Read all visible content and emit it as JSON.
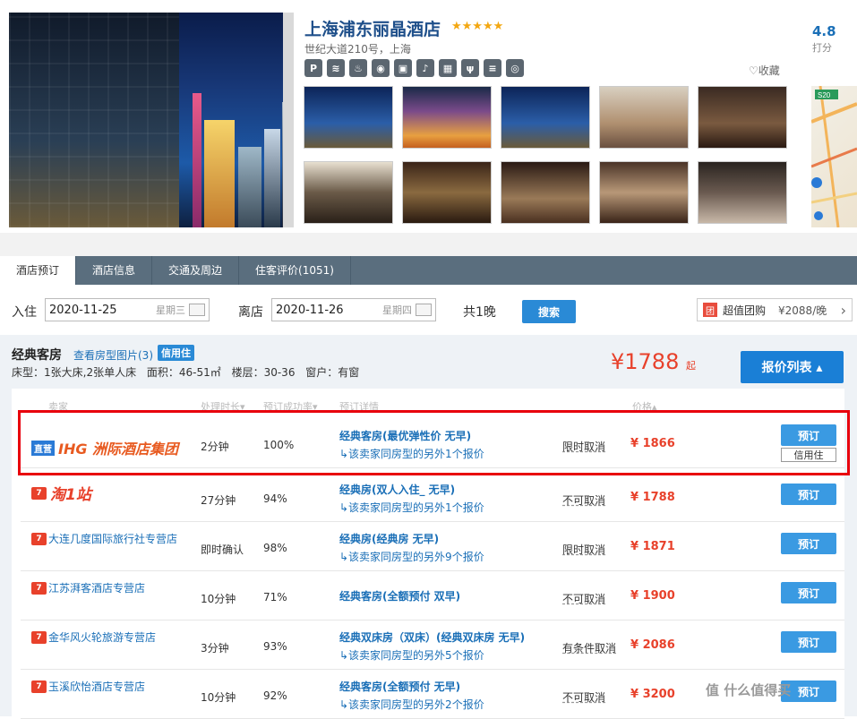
{
  "hotel": {
    "name": "上海浦东丽晶酒店",
    "stars": "★★★★★",
    "address": "世纪大道210号，上海",
    "amenity_icons": [
      "parking-icon",
      "pool-icon",
      "concierge-icon",
      "wifi-icon",
      "luggage-icon",
      "bell-icon",
      "laundry-icon",
      "restaurant-icon",
      "gym-icon",
      "camera-icon"
    ],
    "amenity_glyphs": [
      "P",
      "≋",
      "♨",
      "◉",
      "▣",
      "♪",
      "▦",
      "ψ",
      "≡",
      "◎"
    ],
    "favorite": "♡收藏",
    "score": "4.8",
    "score_label": "打分"
  },
  "tabs": [
    "酒店预订",
    "酒店信息",
    "交通及周边",
    "住客评价(1051)"
  ],
  "search": {
    "checkin_label": "入住",
    "checkin_date": "2020-11-25",
    "checkin_weekday": "星期三",
    "checkout_label": "离店",
    "checkout_date": "2020-11-26",
    "checkout_weekday": "星期四",
    "nights": "共1晚",
    "search_button": "搜索"
  },
  "groupbuy": {
    "icon": "团",
    "label": "超值团购",
    "price": "¥2088/晚",
    "arrow": "›"
  },
  "room": {
    "name": "经典客房",
    "view_images": "查看房型图片(3)",
    "credit_badge": "信用住",
    "info": "床型：1张大床,2张单人床 面积：46-51㎡ 楼层：30-36 窗户：有窗",
    "min_price": "¥1788",
    "min_price_suffix": "起",
    "price_list_button": "报价列表 ▴"
  },
  "table_headers": {
    "seller": "卖家",
    "handle_time": "处理时长▾",
    "success_rate": "预订成功率▾",
    "detail": "预订详情",
    "price": "价格▴"
  },
  "offers": [
    {
      "seller": "IHG 洲际酒店集团",
      "seller_tag": "直营",
      "time": "2分钟",
      "rate": "100%",
      "main": "经典客房(最优弹性价 无早)",
      "sub": "↳该卖家同房型的另外1个报价",
      "cancel": "限时取消",
      "price": "¥ 1866",
      "book": "预订",
      "credit": "信用住"
    },
    {
      "seller": "淘1站",
      "time": "27分钟",
      "rate": "94%",
      "main": "经典房(双人入住_ 无早)",
      "sub": "↳该卖家同房型的另外1个报价",
      "cancel": "不可取消",
      "price": "¥ 1788",
      "book": "预订"
    },
    {
      "seller": "大连几度国际旅行社专营店",
      "time": "即时确认",
      "rate": "98%",
      "main": "经典房(经典房 无早)",
      "sub": "↳该卖家同房型的另外9个报价",
      "cancel": "限时取消",
      "price": "¥ 1871",
      "book": "预订"
    },
    {
      "seller": "江苏湃客酒店专营店",
      "time": "10分钟",
      "rate": "71%",
      "main": "经典客房(全额预付 双早)",
      "sub": "",
      "cancel": "不可取消",
      "price": "¥ 1900",
      "book": "预订"
    },
    {
      "seller": "金华风火轮旅游专营店",
      "time": "3分钟",
      "rate": "93%",
      "main": "经典双床房（双床）(经典双床房 无早)",
      "sub": "↳该卖家同房型的另外5个报价",
      "cancel": "有条件取消",
      "price": "¥ 2086",
      "book": "预订"
    },
    {
      "seller": "玉溪欣怡酒店专营店",
      "time": "10分钟",
      "rate": "92%",
      "main": "经典客房(全额预付 无早)",
      "sub": "↳该卖家同房型的另外2个报价",
      "cancel": "不可取消",
      "price": "¥ 3200",
      "book": "预订"
    }
  ],
  "watermark": "值 什么值得买",
  "colors": {
    "accent": "#1a7fd6",
    "price": "#e8412b",
    "highlight": "#e8000c",
    "tabbar": "#5a6e7e"
  }
}
